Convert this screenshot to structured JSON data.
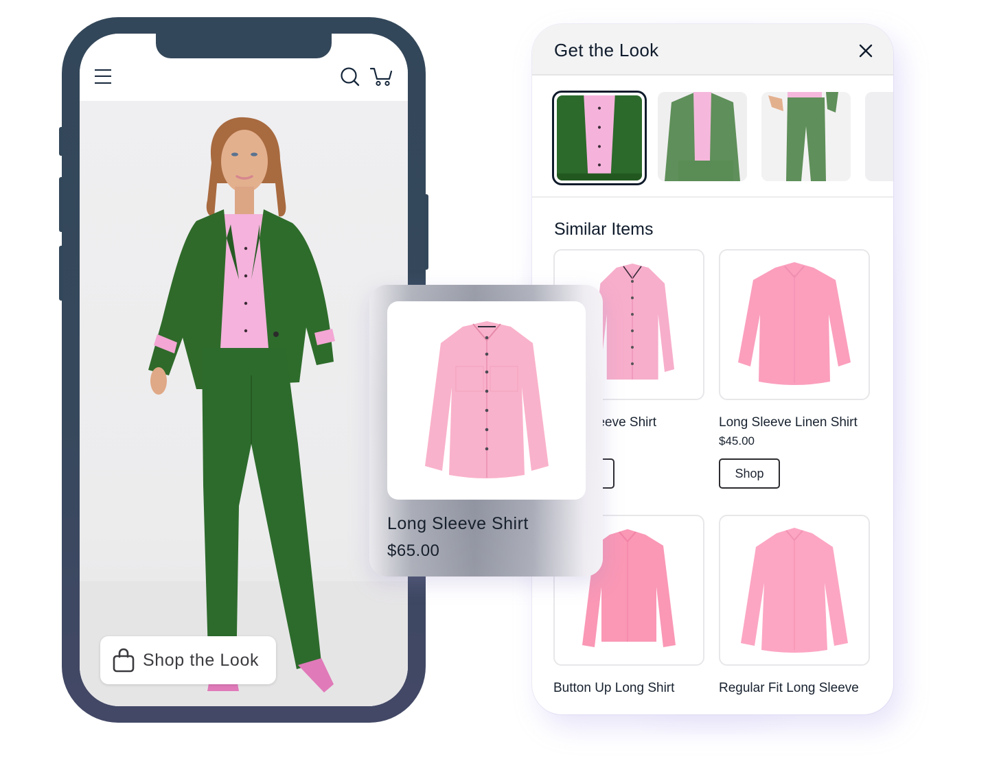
{
  "phone": {
    "header": {
      "menu_icon": "hamburger-menu-icon",
      "search_icon": "search-icon",
      "cart_icon": "shopping-cart-icon"
    },
    "hero_image_alt": "Model wearing green suit with pink shirt",
    "shop_the_look_button": {
      "label": "Shop the Look",
      "icon": "shopping-bag-icon"
    }
  },
  "panel": {
    "title": "Get the Look",
    "close_icon": "close-icon",
    "thumbnails": [
      {
        "alt": "Green blazer with pink shirt",
        "selected": true
      },
      {
        "alt": "Green blazer full view",
        "selected": false
      },
      {
        "alt": "Green trousers",
        "selected": false
      },
      {
        "alt": "Additional look",
        "selected": false
      }
    ],
    "similar_title": "Similar Items",
    "items": [
      {
        "name": "Long Sleeve Shirt",
        "visible_name": "eeve Shirt",
        "price": "",
        "shop_label": ""
      },
      {
        "name": "Long Sleeve Linen Shirt",
        "price": "$45.00",
        "shop_label": "Shop"
      },
      {
        "name": "Button Up Long Shirt"
      },
      {
        "name": "Regular Fit Long Sleeve"
      }
    ]
  },
  "floating_card": {
    "name": "Long Sleeve Shirt",
    "price": "$65.00"
  },
  "colors": {
    "phone_frame": "#33475a",
    "phone_frame_bottom": "#434866",
    "suit_green": "#2f6b2c",
    "shirt_pink": "#f7a9c4",
    "text_dark": "#0f1b2b"
  }
}
